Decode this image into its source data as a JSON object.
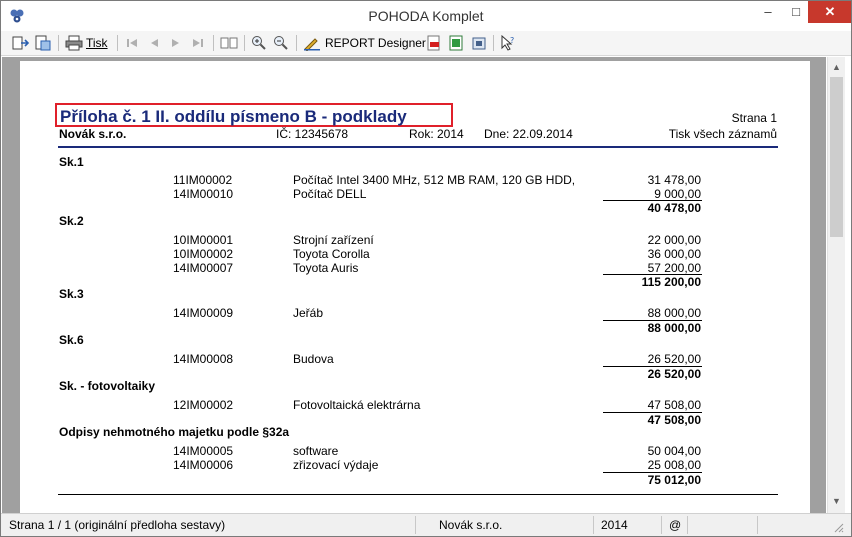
{
  "window": {
    "title": "POHODA Komplet",
    "min": "–",
    "max": "□",
    "close": "✕"
  },
  "toolbar": {
    "print_label": "Tisk",
    "report_designer_label": "REPORT Designer"
  },
  "report": {
    "title": "Příloha č. 1 II. oddílu písmeno B - podklady",
    "page_label": "Strana 1",
    "company": "Novák s.r.o.",
    "ic": "IČ: 12345678",
    "year": "Rok: 2014",
    "date": "Dne: 22.09.2014",
    "mode": "Tisk všech záznamů",
    "groups": [
      {
        "name": "Sk.1",
        "items": [
          {
            "code": "11IM00002",
            "desc": "Počítač Intel 3400 MHz, 512 MB RAM, 120 GB HDD,",
            "amount": "31 478,00"
          },
          {
            "code": "14IM00010",
            "desc": "Počítač DELL",
            "amount": "9 000,00"
          }
        ],
        "total": "40 478,00"
      },
      {
        "name": "Sk.2",
        "items": [
          {
            "code": "10IM00001",
            "desc": "Strojní zařízení",
            "amount": "22 000,00"
          },
          {
            "code": "10IM00002",
            "desc": "Toyota Corolla",
            "amount": "36 000,00"
          },
          {
            "code": "14IM00007",
            "desc": "Toyota Auris",
            "amount": "57 200,00"
          }
        ],
        "total": "115 200,00"
      },
      {
        "name": "Sk.3",
        "items": [
          {
            "code": "14IM00009",
            "desc": "Jeřáb",
            "amount": "88 000,00"
          }
        ],
        "total": "88 000,00"
      },
      {
        "name": "Sk.6",
        "items": [
          {
            "code": "14IM00008",
            "desc": "Budova",
            "amount": "26 520,00"
          }
        ],
        "total": "26 520,00"
      },
      {
        "name": "Sk. - fotovoltaiky",
        "items": [
          {
            "code": "12IM00002",
            "desc": "Fotovoltaická elektrárna",
            "amount": "47 508,00"
          }
        ],
        "total": "47 508,00"
      },
      {
        "name": "Odpisy nehmotného majetku podle §32a",
        "items": [
          {
            "code": "14IM00005",
            "desc": "software",
            "amount": "50 004,00"
          },
          {
            "code": "14IM00006",
            "desc": "zřizovací výdaje",
            "amount": "25 008,00"
          }
        ],
        "total": "75 012,00"
      }
    ]
  },
  "status": {
    "pages": "Strana 1 / 1  (originální předloha sestavy)",
    "company": "Novák s.r.o.",
    "year": "2014",
    "at": "@"
  }
}
